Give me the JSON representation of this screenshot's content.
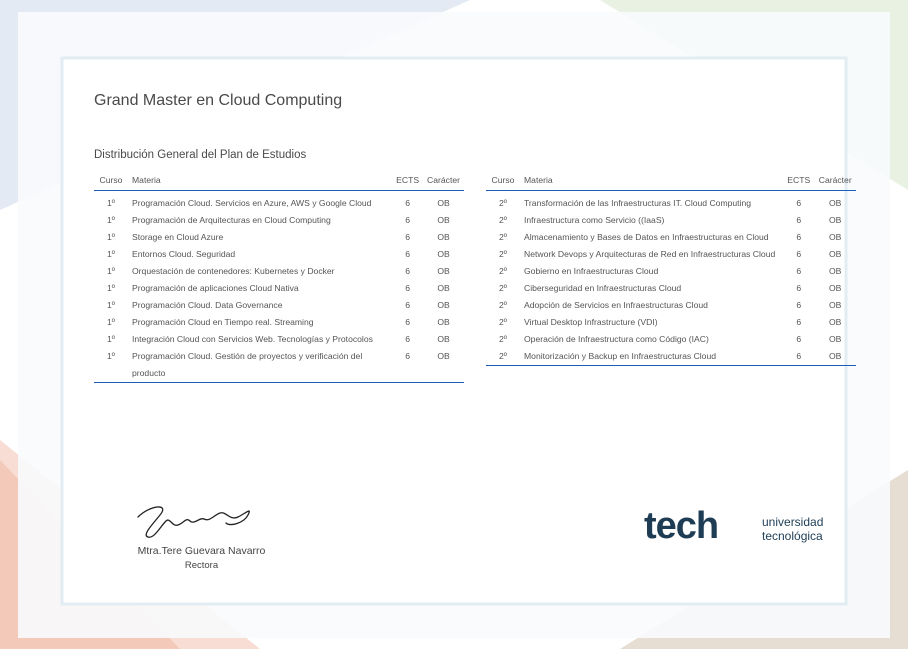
{
  "document": {
    "title": "Grand Master en Cloud Computing",
    "subtitle": "Distribución General del Plan de Estudios"
  },
  "table_headers": {
    "curso": "Curso",
    "materia": "Materia",
    "ects": "ECTS",
    "caracter": "Carácter"
  },
  "left_rows": [
    {
      "curso": "1º",
      "materia": "Programación Cloud. Servicios en Azure, AWS y Google Cloud",
      "ects": "6",
      "caracter": "OB"
    },
    {
      "curso": "1º",
      "materia": "Programación de Arquitecturas en Cloud Computing",
      "ects": "6",
      "caracter": "OB"
    },
    {
      "curso": "1º",
      "materia": "Storage en Cloud Azure",
      "ects": "6",
      "caracter": "OB"
    },
    {
      "curso": "1º",
      "materia": "Entornos Cloud. Seguridad",
      "ects": "6",
      "caracter": "OB"
    },
    {
      "curso": "1º",
      "materia": "Orquestación de contenedores: Kubernetes y Docker",
      "ects": "6",
      "caracter": "OB"
    },
    {
      "curso": "1º",
      "materia": "Programación de aplicaciones Cloud Nativa",
      "ects": "6",
      "caracter": "OB"
    },
    {
      "curso": "1º",
      "materia": "Programación Cloud. Data Governance",
      "ects": "6",
      "caracter": "OB"
    },
    {
      "curso": "1º",
      "materia": "Programación Cloud en Tiempo real. Streaming",
      "ects": "6",
      "caracter": "OB"
    },
    {
      "curso": "1º",
      "materia": "Integración Cloud con Servicios Web. Tecnologías y Protocolos",
      "ects": "6",
      "caracter": "OB"
    },
    {
      "curso": "1º",
      "materia": "Programación Cloud. Gestión de proyectos y verificación del producto",
      "ects": "6",
      "caracter": "OB"
    }
  ],
  "right_rows": [
    {
      "curso": "2º",
      "materia": "Transformación de las Infraestructuras IT. Cloud Computing",
      "ects": "6",
      "caracter": "OB"
    },
    {
      "curso": "2º",
      "materia": "Infraestructura como Servicio ((IaaS)",
      "ects": "6",
      "caracter": "OB"
    },
    {
      "curso": "2º",
      "materia": "Almacenamiento y Bases de Datos en Infraestructuras en Cloud",
      "ects": "6",
      "caracter": "OB"
    },
    {
      "curso": "2º",
      "materia": "Network Devops y Arquitecturas de Red en Infraestructuras Cloud",
      "ects": "6",
      "caracter": "OB"
    },
    {
      "curso": "2º",
      "materia": "Gobierno en Infraestructuras Cloud",
      "ects": "6",
      "caracter": "OB"
    },
    {
      "curso": "2º",
      "materia": "Ciberseguridad en Infraestructuras Cloud",
      "ects": "6",
      "caracter": "OB"
    },
    {
      "curso": "2º",
      "materia": "Adopción de Servicios en Infraestructuras Cloud",
      "ects": "6",
      "caracter": "OB"
    },
    {
      "curso": "2º",
      "materia": "Virtual Desktop Infrastructure (VDI)",
      "ects": "6",
      "caracter": "OB"
    },
    {
      "curso": "2º",
      "materia": "Operación de Infraestructura como Código (IAC)",
      "ects": "6",
      "caracter": "OB"
    },
    {
      "curso": "2º",
      "materia": "Monitorización y Backup en Infraestructuras Cloud",
      "ects": "6",
      "caracter": "OB"
    }
  ],
  "signature": {
    "name": "Mtra.Tere Guevara Navarro",
    "role": "Rectora"
  },
  "logo": {
    "word": "tech",
    "line1": "universidad",
    "line2": "tecnológica",
    "brand_color": "#1e3d55",
    "accent_color": "#1b5fb5"
  }
}
